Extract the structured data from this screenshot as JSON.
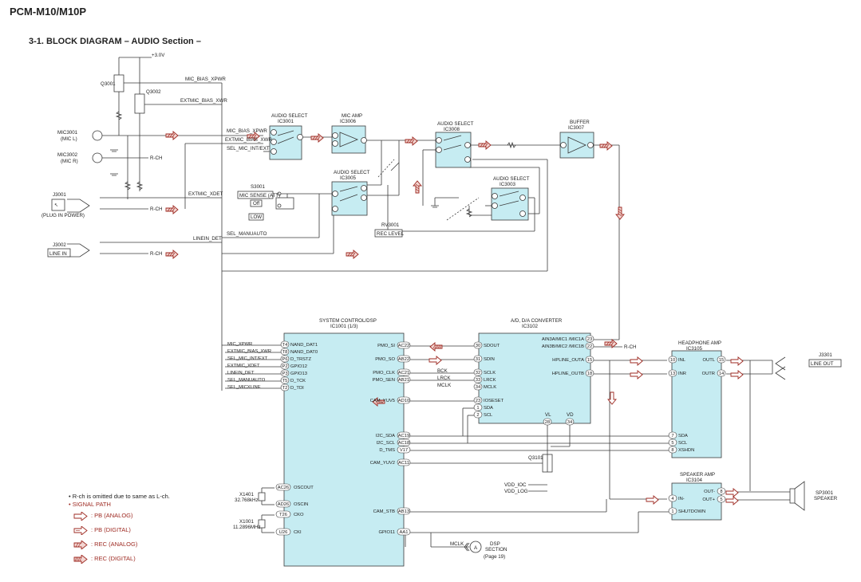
{
  "header": {
    "model": "PCM-M10/M10P",
    "section": "3-1.   BLOCK  DIAGRAM  – AUDIO Section –"
  },
  "blocks": {
    "ic3001": {
      "t1": "AUDIO SELECT",
      "t2": "IC3001"
    },
    "ic3006": {
      "t1": "MIC AMP",
      "t2": "IC3006"
    },
    "ic3008": {
      "t1": "AUDIO SELECT",
      "t2": "IC3008"
    },
    "ic3007": {
      "t1": "BUFFER",
      "t2": "IC3007"
    },
    "ic3005": {
      "t1": "AUDIO SELECT",
      "t2": "IC3005"
    },
    "ic3003": {
      "t1": "AUDIO SELECT",
      "t2": "IC3003"
    },
    "ic1001": {
      "t1": "SYSTEM CONTROL/DSP",
      "t2": "IC1001 (1/3)"
    },
    "ic3102": {
      "t1": "A/D, D/A CONVERTER",
      "t2": "IC3102"
    },
    "ic3105": {
      "t1": "HEADPHONE AMP",
      "t2": "IC3105"
    },
    "ic3104": {
      "t1": "SPEAKER AMP",
      "t2": "IC3104"
    }
  },
  "components": {
    "supply": "+3.0V",
    "q3001": "Q3001",
    "q3002": "Q3002",
    "mic1": [
      "MIC3001",
      "(MIC L)"
    ],
    "mic2": [
      "MIC3002",
      "(MIC R)"
    ],
    "j3001": [
      "J3001",
      "(PLUG IN POWER)"
    ],
    "j3002": "J3002",
    "line_in": "LINE IN",
    "s3001": "S3001",
    "mic_sense": "MIC SENSE (ATT)",
    "sense_off": "Off",
    "sense_low": "LOW",
    "rv3001": "RV3001",
    "rec_level": "REC LEVEL",
    "j3301": "J3301",
    "line_out": "LINE OUT",
    "sp3001": [
      "SP3001",
      "SPEAKER"
    ],
    "q3101": "Q3101",
    "x1401": [
      "X1401",
      "32.768kHz"
    ],
    "x1001": [
      "X1001",
      "11.2896MHz"
    ],
    "vdd_ioc": "VDD_IOC",
    "vdd_log": "VDD_LOG",
    "mclk": "MCLK",
    "dsp_ref": "A",
    "dsp_section": [
      "DSP",
      "SECTION",
      "(Page 19)"
    ]
  },
  "nets": {
    "mic_bias": "MIC_BIAS_XPWR",
    "extmic_bias": "EXTMIC_BIAS_XWR",
    "sel_mic_int": "SEL_MIC_INT/EXT",
    "extmic_xdet": "EXTMIC_XDET",
    "linein_det": "LINEIN_DET",
    "sel_manu": "SEL_MANUAUTO",
    "sel_micline": "SEL_MICXLINE",
    "rch1": "R-CH",
    "rch2": "R-CH",
    "rch3": "R-CH",
    "rch4": "R-CH",
    "bck": "BCK",
    "lrck": "LRCK",
    "mclk_bus": "MCLK",
    "vl": "VL",
    "vd": "VD"
  },
  "pins": {
    "ic1001_left": [
      {
        "net": "MIC_XPWR",
        "pin": "T4",
        "name": "NAND_DAT1"
      },
      {
        "net": "EXTMIC_BIAS_XWR",
        "pin": "T8",
        "name": "NAND_DAT0"
      },
      {
        "net": "SEL_MIC_INT/EXT",
        "pin": "P6",
        "name": "D_TRSTZ"
      },
      {
        "net": "EXTMIC_XDET",
        "pin": "P2",
        "name": "GPIO12"
      },
      {
        "net": "LINEIN_DET",
        "pin": "P3",
        "name": "GPIO13"
      },
      {
        "net": "SEL_MANUAUTO",
        "pin": "T5",
        "name": "D_TCK"
      },
      {
        "net": "SEL_MICXLINE",
        "pin": "T2",
        "name": "D_TDI"
      }
    ],
    "ic1001_right": [
      {
        "name": "PMO_SI",
        "pin": "AC22"
      },
      {
        "name": "PMO_SO",
        "pin": "AB22"
      },
      {
        "name": "PMO_CLK",
        "pin": "AC21"
      },
      {
        "name": "PMO_SEN",
        "pin": "AB21"
      },
      {
        "name": "CAM_YUV5",
        "pin": "AD10"
      },
      {
        "name": "I2C_SDA",
        "pin": "AC19"
      },
      {
        "name": "I2C_SCL",
        "pin": "AC18"
      },
      {
        "name": "D_TMS",
        "pin": "V17"
      },
      {
        "name": "CAM_YUV2",
        "pin": "AC11"
      },
      {
        "name": "CAM_STB",
        "pin": "AB13"
      },
      {
        "name": "GPIO11",
        "pin": "AA1"
      }
    ],
    "ic1001_osc": [
      {
        "name": "OSCOUT",
        "pin": "AC26"
      },
      {
        "name": "OSCIN",
        "pin": "AD26"
      },
      {
        "name": "CKO",
        "pin": "T26"
      },
      {
        "name": "CKI",
        "pin": "U26"
      }
    ],
    "ic3102_left": [
      {
        "name": "SDOUT",
        "pin": "30"
      },
      {
        "name": "SDIN",
        "pin": "31"
      },
      {
        "name": "SCLK",
        "pin": "32"
      },
      {
        "name": "LRCK",
        "pin": "33"
      },
      {
        "name": "MCLK",
        "pin": "34"
      },
      {
        "name": "IOSESET",
        "pin": "23"
      },
      {
        "name": "SDA",
        "pin": "1"
      },
      {
        "name": "SCL",
        "pin": "2"
      }
    ],
    "ic3102_right": [
      {
        "name": "AIN3A/MIC1 /MIC1A",
        "pin": "23"
      },
      {
        "name": "AIN3B/MIC2 /MIC1B",
        "pin": "22"
      },
      {
        "name": "HPLINE_OUTA",
        "pin": "15"
      },
      {
        "name": "HPLINE_OUTB",
        "pin": "18"
      }
    ],
    "ic3102_bottom": [
      {
        "name": "VL",
        "pin": "28"
      },
      {
        "name": "VD",
        "pin": "34"
      }
    ],
    "ic3105_left": [
      {
        "name": "INL",
        "pin": "10"
      },
      {
        "name": "INR",
        "pin": "13"
      },
      {
        "name": "SDA",
        "pin": "7"
      },
      {
        "name": "SCL",
        "pin": "5"
      },
      {
        "name": "XSHDN",
        "pin": "8"
      }
    ],
    "ic3105_right": [
      {
        "name": "OUTL",
        "pin": "15"
      },
      {
        "name": "OUTR",
        "pin": "14"
      }
    ],
    "ic3104_left": [
      {
        "name": "IN-",
        "pin": "4"
      },
      {
        "name": "SHUTDOWN",
        "pin": "1"
      }
    ],
    "ic3104_right": [
      {
        "name": "OUT-",
        "pin": "8"
      },
      {
        "name": "OUT+",
        "pin": "5"
      }
    ]
  },
  "legend": {
    "note": "• R-ch is omitted due to same as L-ch.",
    "signal_path": "• SIGNAL PATH",
    "items": [
      {
        "label": ": PB (ANALOG)"
      },
      {
        "label": ": PB (DIGITAL)"
      },
      {
        "label": ": REC (ANALOG)"
      },
      {
        "label": ": REC (DIGITAL)"
      }
    ]
  },
  "colors": {
    "ic_fill": "#c6ecf2",
    "line": "#3a3a3a",
    "signal": "#9e2a22",
    "text": "#222222"
  }
}
